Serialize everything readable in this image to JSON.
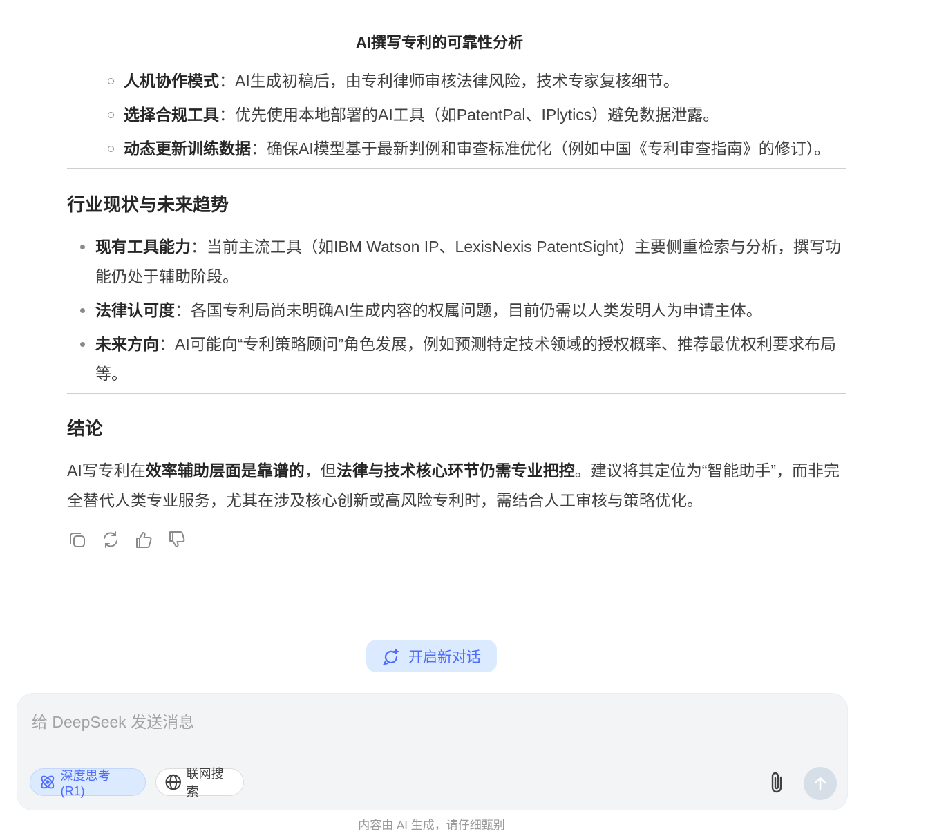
{
  "header": {
    "title": "AI撰写专利的可靠性分析"
  },
  "tips": [
    {
      "bold": "人机协作模式",
      "text": "：AI生成初稿后，由专利律师审核法律风险，技术专家复核细节。"
    },
    {
      "bold": "选择合规工具",
      "text": "：优先使用本地部署的AI工具（如PatentPal、IPlytics）避免数据泄露。"
    },
    {
      "bold": "动态更新训练数据",
      "text": "：确保AI模型基于最新判例和审查标准优化（例如中国《专利审查指南》的修订）。"
    }
  ],
  "industry": {
    "heading": "行业现状与未来趋势",
    "items": [
      {
        "bold": "现有工具能力",
        "text": "：当前主流工具（如IBM Watson IP、LexisNexis PatentSight）主要侧重检索与分析，撰写功能仍处于辅助阶段。"
      },
      {
        "bold": "法律认可度",
        "text": "：各国专利局尚未明确AI生成内容的权属问题，目前仍需以人类发明人为申请主体。"
      },
      {
        "bold": "未来方向",
        "text": "：AI可能向“专利策略顾问”角色发展，例如预测特定技术领域的授权概率、推荐最优权利要求布局等。"
      }
    ]
  },
  "conclusion": {
    "heading": "结论",
    "p1": "AI写专利在",
    "b1": "效率辅助层面是靠谱的",
    "p2": "，但",
    "b2": "法律与技术核心环节仍需专业把控",
    "p3": "。建议将其定位为“智能助手”，而非完全替代人类专业服务，尤其在涉及核心创新或高风险专利时，需结合人工审核与策略优化。"
  },
  "actions": {
    "icons": [
      "copy-icon",
      "regenerate-icon",
      "thumbs-up-icon",
      "thumbs-down-icon"
    ]
  },
  "new_chat": {
    "label": "开启新对话",
    "icon": "new-chat-icon"
  },
  "composer": {
    "placeholder": "给 DeepSeek 发送消息",
    "deep_think_label": "深度思考 (R1)",
    "web_search_label": "联网搜索",
    "attach_icon": "paperclip-icon",
    "send_icon": "arrow-up-icon"
  },
  "footer": {
    "disclaimer": "内容由 AI 生成，请仔细甄别"
  },
  "colors": {
    "accent": "#4d6bfe",
    "accent_bg": "#dbeafe",
    "text": "#404040"
  }
}
